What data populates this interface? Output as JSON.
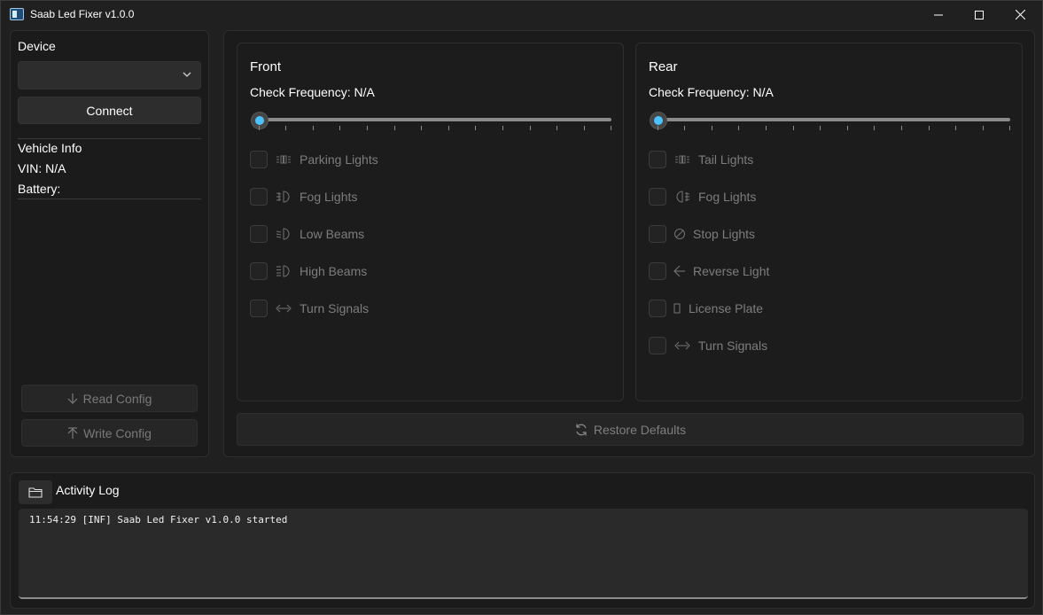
{
  "window": {
    "title": "Saab Led Fixer v1.0.0"
  },
  "sidebar": {
    "device_label": "Device",
    "device_select_value": "",
    "connect_label": "Connect",
    "vehicle_info_label": "Vehicle Info",
    "vin_text": "VIN: N/A",
    "battery_text": "Battery:",
    "read_config_label": "Read Config",
    "write_config_label": "Write Config"
  },
  "front": {
    "title": "Front",
    "frequency_text": "Check Frequency: N/A",
    "items": [
      {
        "label": "Parking Lights",
        "icon": "parking-lights-icon"
      },
      {
        "label": "Fog Lights",
        "icon": "fog-lights-icon"
      },
      {
        "label": "Low Beams",
        "icon": "low-beams-icon"
      },
      {
        "label": "High Beams",
        "icon": "high-beams-icon"
      },
      {
        "label": "Turn Signals",
        "icon": "turn-signals-icon"
      }
    ]
  },
  "rear": {
    "title": "Rear",
    "frequency_text": "Check Frequency: N/A",
    "items": [
      {
        "label": "Tail Lights",
        "icon": "tail-lights-icon"
      },
      {
        "label": "Fog Lights",
        "icon": "rear-fog-icon"
      },
      {
        "label": "Stop Lights",
        "icon": "stop-icon"
      },
      {
        "label": "Reverse Light",
        "icon": "reverse-arrow-icon"
      },
      {
        "label": "License Plate",
        "icon": "license-plate-icon"
      },
      {
        "label": "Turn Signals",
        "icon": "turn-signals-icon"
      }
    ]
  },
  "restore_label": "Restore Defaults",
  "log": {
    "title": "Activity Log",
    "lines": [
      "11:54:29 [INF] Saab Led Fixer v1.0.0 started"
    ]
  },
  "colors": {
    "accent": "#4cc2ff",
    "background": "#202020",
    "panel": "#1b1b1b",
    "disabled_text": "#7d7d7d"
  }
}
